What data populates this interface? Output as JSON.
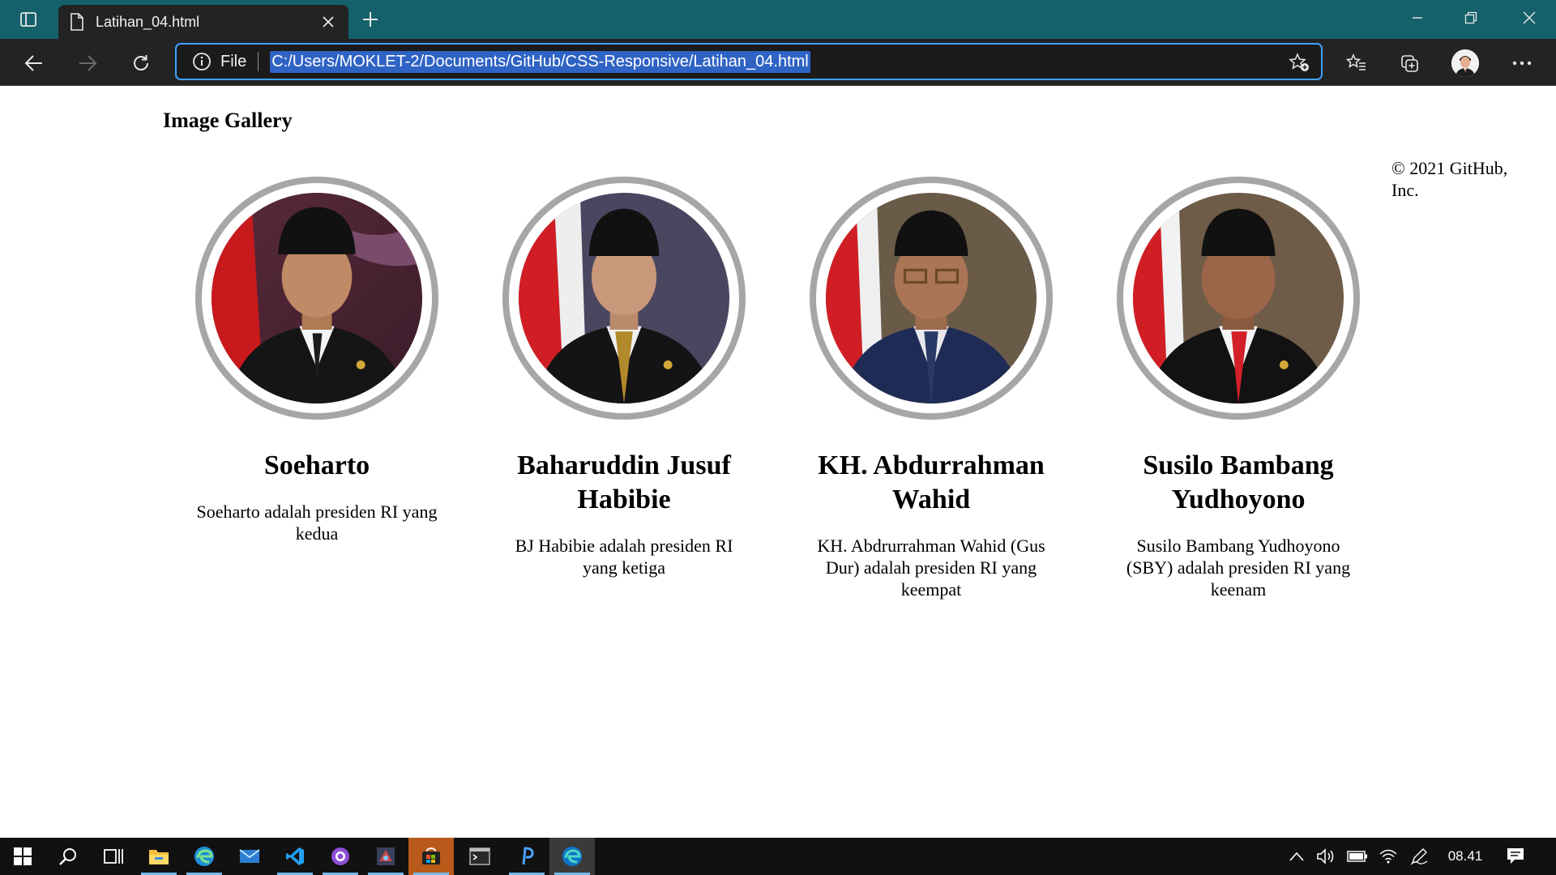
{
  "browser": {
    "tab_title": "Latihan_04.html",
    "scheme_label": "File",
    "url": "C:/Users/MOKLET-2/Documents/GitHub/CSS-Responsive/Latihan_04.html",
    "icons": [
      "tab-actions-icon",
      "file-icon",
      "close-icon",
      "plus-icon",
      "minimize-icon",
      "restore-icon",
      "close-window-icon",
      "back-arrow-icon",
      "forward-arrow-icon",
      "refresh-icon",
      "info-icon",
      "add-favorite-icon",
      "favorites-icon",
      "collections-icon",
      "profile-avatar",
      "more-icon"
    ],
    "accent_color": "#3ea2ff",
    "titlebar_color": "#14616b"
  },
  "page": {
    "title": "Image Gallery",
    "footer_line1": "© 2021 GitHub,",
    "footer_line2": "Inc.",
    "cards": [
      {
        "name": "Soeharto",
        "description": "Soeharto adalah presiden RI yang kedua"
      },
      {
        "name": "Baharuddin Jusuf Habibie",
        "description": "BJ Habibie adalah presiden RI yang ketiga"
      },
      {
        "name": "KH. Abdurrahman Wahid",
        "description": "KH. Abdrurrahman Wahid (Gus Dur) adalah presiden RI yang keempat"
      },
      {
        "name": "Susilo Bambang Yudhoyono",
        "description": "Susilo Bambang Yudhoyono (SBY) adalah presiden RI yang keenam"
      }
    ]
  },
  "taskbar": {
    "items": [
      "windows-start-icon",
      "search-icon",
      "task-view-icon",
      "file-explorer-icon",
      "edge-icon",
      "mail-icon",
      "vscode-icon",
      "github-desktop-icon",
      "game-icon",
      "store-icon",
      "terminal-icon",
      "phpstorm-icon",
      "edge-dev-icon"
    ],
    "tray": [
      "chevron-up-icon",
      "volume-icon",
      "battery-icon",
      "wifi-icon",
      "pen-icon",
      "notification-icon"
    ],
    "clock": "08.41"
  }
}
